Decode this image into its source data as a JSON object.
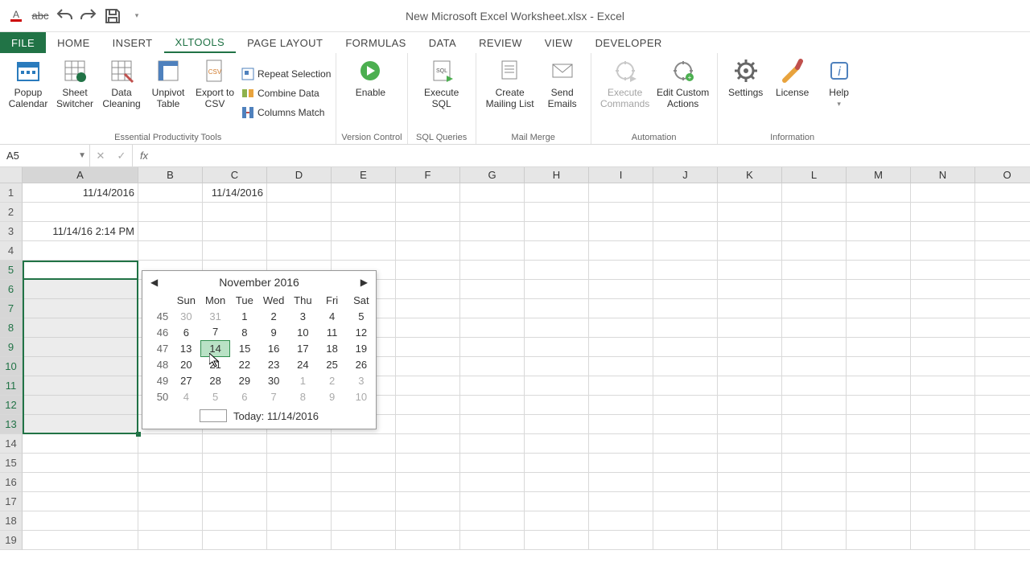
{
  "app_title": "New Microsoft Excel Worksheet.xlsx - Excel",
  "tabs": {
    "file": "FILE",
    "home": "HOME",
    "insert": "INSERT",
    "xltools": "XLTools",
    "page_layout": "PAGE LAYOUT",
    "formulas": "FORMULAS",
    "data": "DATA",
    "review": "REVIEW",
    "view": "VIEW",
    "developer": "DEVELOPER"
  },
  "ribbon": {
    "popup_calendar": "Popup Calendar",
    "sheet_switcher": "Sheet Switcher",
    "data_cleaning": "Data Cleaning",
    "unpivot_table": "Unpivot Table",
    "export_csv": "Export to CSV",
    "repeat_selection": "Repeat Selection",
    "combine_data": "Combine Data",
    "columns_match": "Columns Match",
    "group1": "Essential Productivity Tools",
    "enable": "Enable",
    "group2": "Version Control",
    "execute_sql": "Execute SQL",
    "group3": "SQL Queries",
    "create_mailing": "Create Mailing List",
    "send_emails": "Send Emails",
    "group4": "Mail Merge",
    "execute_commands": "Execute Commands",
    "edit_custom_actions": "Edit Custom Actions",
    "group5": "Automation",
    "settings": "Settings",
    "license": "License",
    "help": "Help",
    "group6": "Information"
  },
  "name_box": "A5",
  "cells": {
    "A1": "11/14/2016",
    "C1": "11/14/2016",
    "A3": "11/14/16 2:14 PM"
  },
  "columns": [
    "A",
    "B",
    "C",
    "D",
    "E",
    "F",
    "G",
    "H",
    "I",
    "J",
    "K",
    "L",
    "M",
    "N",
    "O"
  ],
  "rows": [
    "1",
    "2",
    "3",
    "4",
    "5",
    "6",
    "7",
    "8",
    "9",
    "10",
    "11",
    "12",
    "13",
    "14",
    "15",
    "16",
    "17",
    "18",
    "19"
  ],
  "calendar": {
    "title": "November 2016",
    "days": [
      "Sun",
      "Mon",
      "Tue",
      "Wed",
      "Thu",
      "Fri",
      "Sat"
    ],
    "weeks": [
      {
        "wk": "45",
        "d": [
          "30",
          "31",
          "1",
          "2",
          "3",
          "4",
          "5"
        ],
        "dim": [
          0,
          1
        ]
      },
      {
        "wk": "46",
        "d": [
          "6",
          "7",
          "8",
          "9",
          "10",
          "11",
          "12"
        ],
        "dim": []
      },
      {
        "wk": "47",
        "d": [
          "13",
          "14",
          "15",
          "16",
          "17",
          "18",
          "19"
        ],
        "dim": [],
        "today": 1
      },
      {
        "wk": "48",
        "d": [
          "20",
          "21",
          "22",
          "23",
          "24",
          "25",
          "26"
        ],
        "dim": []
      },
      {
        "wk": "49",
        "d": [
          "27",
          "28",
          "29",
          "30",
          "1",
          "2",
          "3"
        ],
        "dim": [
          4,
          5,
          6
        ]
      },
      {
        "wk": "50",
        "d": [
          "4",
          "5",
          "6",
          "7",
          "8",
          "9",
          "10"
        ],
        "dim": [
          0,
          1,
          2,
          3,
          4,
          5,
          6
        ]
      }
    ],
    "today_label": "Today: 11/14/2016"
  }
}
